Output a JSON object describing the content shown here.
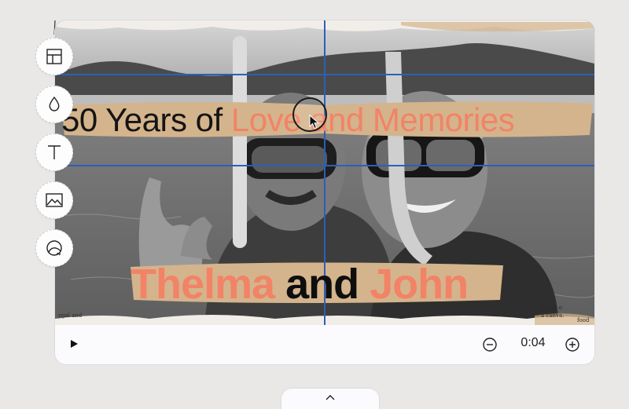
{
  "canvas": {
    "headline": {
      "part1": "50 Years of ",
      "part2": "Love and Memories"
    },
    "names": {
      "first": "Thelma",
      "middle": " and ",
      "last": "John"
    },
    "corner_text_left": "ygal and",
    "corner_text_right_line1": "irame o",
    "corner_text_right_line2": "a canva.",
    "corner_text_right_line3": "food"
  },
  "toolbar": {
    "items": [
      {
        "name": "layout",
        "icon": "layout-grid-icon"
      },
      {
        "name": "color",
        "icon": "droplet-icon"
      },
      {
        "name": "text",
        "icon": "text-icon"
      },
      {
        "name": "image",
        "icon": "image-icon"
      },
      {
        "name": "sticker",
        "icon": "sticker-icon"
      }
    ]
  },
  "player": {
    "play_icon": "play-icon",
    "time": "0:04",
    "zoom_out_icon": "zoom-out-icon",
    "zoom_in_icon": "zoom-in-icon"
  },
  "bottom_panel": {
    "icon": "chevron-up-icon"
  },
  "colors": {
    "accent": "#f28367",
    "guide": "#2e5fb7",
    "tape": "#d4b48c",
    "background": "#e9e8e6"
  }
}
